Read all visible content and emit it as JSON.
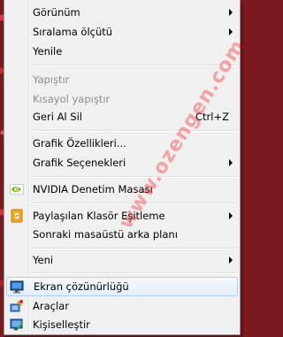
{
  "menu": {
    "items": [
      {
        "label": "Görünüm",
        "submenu": true
      },
      {
        "label": "Sıralama ölçütü",
        "submenu": true
      },
      {
        "label": "Yenile"
      },
      {
        "label": "Yapıştır",
        "disabled": true
      },
      {
        "label": "Kısayol yapıştır",
        "disabled": true
      },
      {
        "label": "Geri Al Sil",
        "shortcut": "Ctrl+Z"
      },
      {
        "label": "Grafik Özellikleri..."
      },
      {
        "label": "Grafik Seçenekleri",
        "submenu": true
      },
      {
        "label": "NVIDIA Denetim Masası",
        "icon": "nvidia-icon"
      },
      {
        "label": "Paylaşılan Klasör Eşitleme",
        "submenu": true,
        "icon": "sync-folder-icon"
      },
      {
        "label": "Sonraki masaüstü arka planı"
      },
      {
        "label": "Yeni",
        "submenu": true
      },
      {
        "label": "Ekran çözünürlüğü",
        "icon": "display-resolution-icon",
        "highlighted": true
      },
      {
        "label": "Araçlar",
        "icon": "tools-icon"
      },
      {
        "label": "Kişiselleştir",
        "icon": "personalize-icon"
      }
    ]
  },
  "watermark": "www.ozengen.com",
  "colors": {
    "menu_bg": "#f0f0f0",
    "highlight_border": "#aecff7",
    "disabled_text": "#8d8d8d",
    "watermark": "#ff0000"
  }
}
